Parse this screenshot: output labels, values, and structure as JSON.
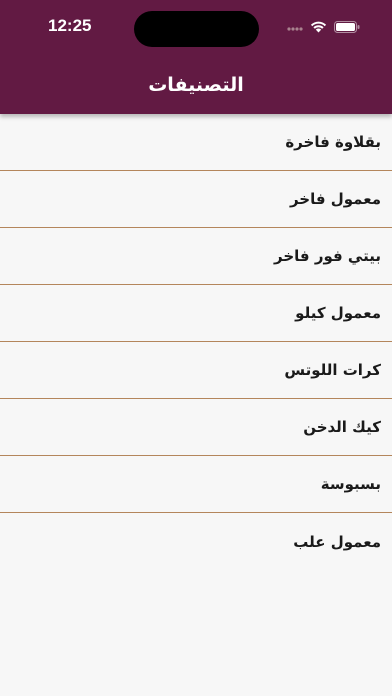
{
  "status_bar": {
    "time": "12:25",
    "icons": [
      "cellular-icon",
      "wifi-icon",
      "battery-icon"
    ]
  },
  "header": {
    "title": "التصنيفات",
    "background": "#621a43"
  },
  "categories": [
    {
      "label": "بقلاوة فاخرة"
    },
    {
      "label": "معمول فاخر"
    },
    {
      "label": "بيتي فور فاخر"
    },
    {
      "label": "معمول كيلو"
    },
    {
      "label": "كرات اللوتس"
    },
    {
      "label": "كيك الدخن"
    },
    {
      "label": "بسبوسة"
    },
    {
      "label": "معمول علب"
    }
  ],
  "colors": {
    "divider": "#b4865c",
    "background": "#f7f7f7"
  }
}
